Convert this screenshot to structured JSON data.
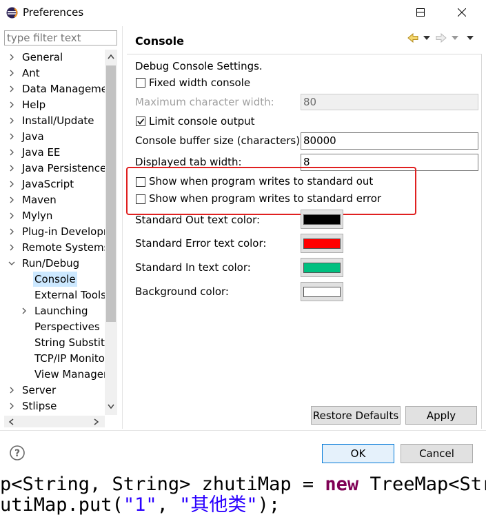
{
  "window": {
    "title": "Preferences",
    "icon": "eclipse-app-icon",
    "controls": [
      "minimize-icon",
      "maximize-icon",
      "close-icon"
    ]
  },
  "filter": {
    "placeholder": "type filter text"
  },
  "tree": {
    "items": [
      {
        "label": "General",
        "expanded": false
      },
      {
        "label": "Ant",
        "expanded": false
      },
      {
        "label": "Data Management",
        "expanded": false
      },
      {
        "label": "Help",
        "expanded": false
      },
      {
        "label": "Install/Update",
        "expanded": false
      },
      {
        "label": "Java",
        "expanded": false
      },
      {
        "label": "Java EE",
        "expanded": false
      },
      {
        "label": "Java Persistence",
        "expanded": false
      },
      {
        "label": "JavaScript",
        "expanded": false
      },
      {
        "label": "Maven",
        "expanded": false
      },
      {
        "label": "Mylyn",
        "expanded": false
      },
      {
        "label": "Plug-in Development",
        "expanded": false
      },
      {
        "label": "Remote Systems",
        "expanded": false
      },
      {
        "label": "Run/Debug",
        "expanded": true
      },
      {
        "label": "Server",
        "expanded": false
      },
      {
        "label": "Stlipse",
        "expanded": false
      }
    ],
    "children": [
      {
        "label": "Console",
        "selected": true
      },
      {
        "label": "External Tools"
      },
      {
        "label": "Launching",
        "expandable": true
      },
      {
        "label": "Perspectives"
      },
      {
        "label": "String Substitution"
      },
      {
        "label": "TCP/IP Monitor"
      },
      {
        "label": "View Management"
      }
    ]
  },
  "page": {
    "title": "Console",
    "nav_icons": [
      "back-arrow-icon",
      "back-menu-icon",
      "forward-arrow-icon",
      "forward-menu-icon",
      "view-menu-icon"
    ],
    "description": "Debug Console Settings.",
    "fixed_width": {
      "label": "Fixed width console",
      "checked": false
    },
    "max_width": {
      "label": "Maximum character width:",
      "value": "80",
      "enabled": false
    },
    "limit_output": {
      "label": "Limit console output",
      "checked": true
    },
    "buffer_size": {
      "label": "Console buffer size (characters):",
      "value": "80000"
    },
    "tab_width": {
      "label": "Displayed tab width:",
      "value": "8"
    },
    "show_out": {
      "label": "Show when program writes to standard out",
      "checked": false
    },
    "show_err": {
      "label": "Show when program writes to standard error",
      "checked": false
    },
    "colors": [
      {
        "label": "Standard Out text color:",
        "color": "#000000"
      },
      {
        "label": "Standard Error text color:",
        "color": "#ff0000"
      },
      {
        "label": "Standard In text color:",
        "color": "#00c080"
      },
      {
        "label": "Background color:",
        "color": "#ffffff"
      }
    ],
    "restore_defaults": "Restore Defaults",
    "apply": "Apply"
  },
  "footer": {
    "help_icon": "help-icon",
    "ok": "OK",
    "cancel": "Cancel"
  },
  "background_code": {
    "line1": "p<String, String> zhutiMap = new TreeMap<String",
    "line2": "utiMap.put(\"1\", \"其他类\");"
  },
  "highlight_color": "#e02020"
}
